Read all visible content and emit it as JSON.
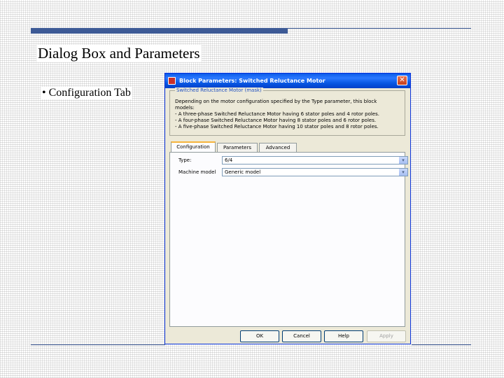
{
  "slide": {
    "title": "Dialog Box and Parameters",
    "bullet": "• Configuration Tab"
  },
  "dialog": {
    "title": "Block Parameters: Switched Reluctance Motor",
    "close_glyph": "✕",
    "group_title": "Switched Reluctance Motor (mask)",
    "description": [
      "Depending on the motor configuration specified by the Type parameter, this block",
      "models:",
      "- A three-phase Switched Reluctance Motor having 6 stator poles and 4 rotor poles.",
      "- A four-phase Switched Reluctance Motor having 8 stator poles and 6 rotor poles.",
      "- A five-phase Switched Reluctance Motor having 10 stator poles and 8 rotor poles."
    ],
    "tabs": [
      "Configuration",
      "Parameters",
      "Advanced"
    ],
    "fields": [
      {
        "label": "Type:",
        "value": "6/4"
      },
      {
        "label": "Machine model",
        "value": "Generic model"
      }
    ],
    "buttons": [
      "OK",
      "Cancel",
      "Help",
      "Apply"
    ]
  },
  "icons": {
    "dropdown": "▾"
  },
  "colors": {
    "accent": "#3d5a96",
    "titlebar": "#0a5ae8",
    "dialog_bg": "#ece9d8",
    "active_tab_highlight": "#f6b43c"
  }
}
